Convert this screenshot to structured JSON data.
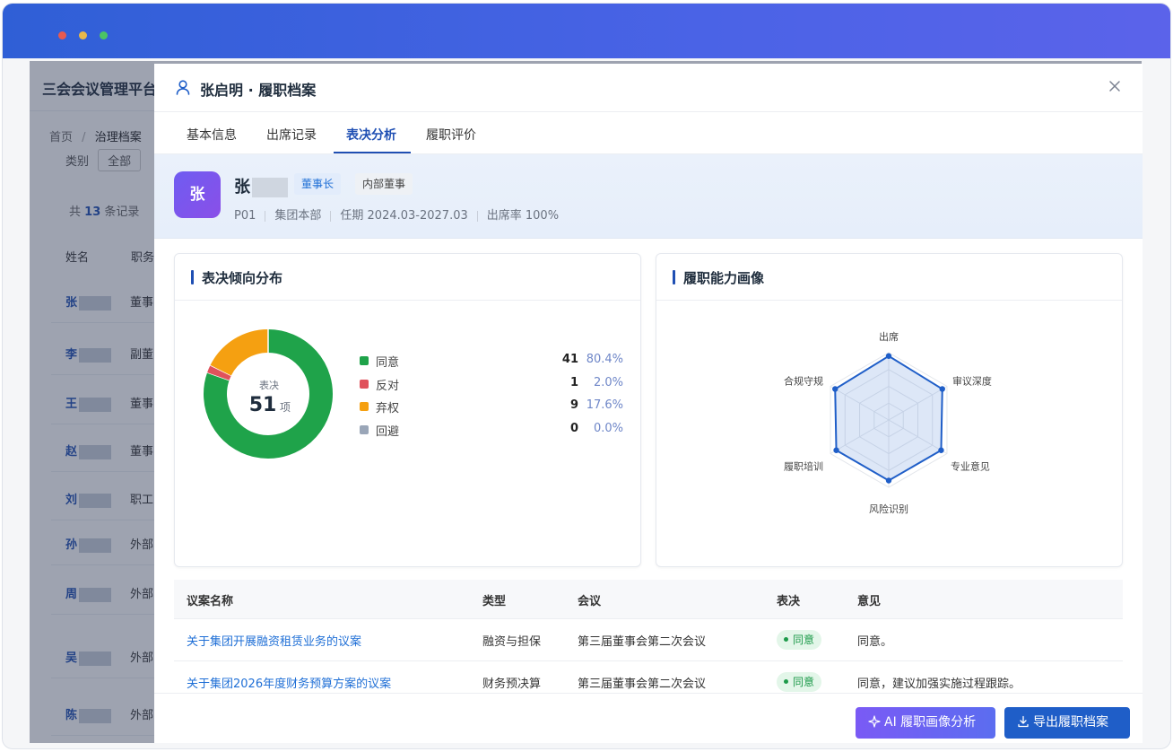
{
  "bg": {
    "title": "三会会议管理平台",
    "crumb_home": "首页",
    "crumb_sep": "/",
    "crumb_current": "治理档案",
    "filter_label": "类别",
    "filter_value": "全部",
    "count_prefix": "共",
    "count": "13",
    "count_suffix": "条记录",
    "col_name": "姓名",
    "col_role": "职务",
    "rows": [
      {
        "initial": "张",
        "role": "董事"
      },
      {
        "initial": "李",
        "role": "副董"
      },
      {
        "initial": "王",
        "role": "董事"
      },
      {
        "initial": "赵",
        "role": "董事"
      },
      {
        "initial": "刘",
        "role": "职工"
      },
      {
        "initial": "孙",
        "role": "外部"
      },
      {
        "initial": "周",
        "role": "外部"
      },
      {
        "initial": "吴",
        "role": "外部"
      },
      {
        "initial": "陈",
        "role": "外部"
      }
    ]
  },
  "drawer": {
    "title": "张启明 · 履职档案",
    "tabs": [
      "基本信息",
      "出席记录",
      "表决分析",
      "履职评价"
    ],
    "active_tab": "表决分析"
  },
  "profile": {
    "avatar": "张",
    "name_initial": "张",
    "tag_role": "董事长",
    "tag_type": "内部董事",
    "meta": [
      "P01",
      "集团本部",
      "任期 2024.03-2027.03",
      "出席率 100%"
    ]
  },
  "vote_card": {
    "title": "表决倾向分布",
    "center_label": "表决",
    "center_total": "51",
    "center_unit": "项",
    "legend": [
      {
        "label": "同意",
        "count": "41",
        "pct": "80.4%",
        "color": "#1fa34a"
      },
      {
        "label": "反对",
        "count": "1",
        "pct": "2.0%",
        "color": "#e0525c"
      },
      {
        "label": "弃权",
        "count": "9",
        "pct": "17.6%",
        "color": "#f5a011"
      },
      {
        "label": "回避",
        "count": "0",
        "pct": "0.0%",
        "color": "#9aa6b8"
      }
    ]
  },
  "radar_card": {
    "title": "履职能力画像",
    "axes": [
      "出席",
      "审议深度",
      "专业意见",
      "风险识别",
      "履职培训",
      "合规守规"
    ],
    "values": [
      0.95,
      0.92,
      0.9,
      0.9,
      0.9,
      0.92
    ]
  },
  "table": {
    "headers": [
      "议案名称",
      "类型",
      "会议",
      "表决",
      "意见"
    ],
    "rows": [
      {
        "name": "关于集团开展融资租赁业务的议案",
        "type": "融资与担保",
        "meeting": "第三届董事会第二次会议",
        "vote": "同意",
        "opinion": "同意。"
      },
      {
        "name": "关于集团2026年度财务预算方案的议案",
        "type": "财务预决算",
        "meeting": "第三届董事会第二次会议",
        "vote": "同意",
        "opinion": "同意，建议加强实施过程跟踪。"
      }
    ]
  },
  "footer": {
    "ai_button": "AI 履职画像分析",
    "export_button": "导出履职档案"
  }
}
